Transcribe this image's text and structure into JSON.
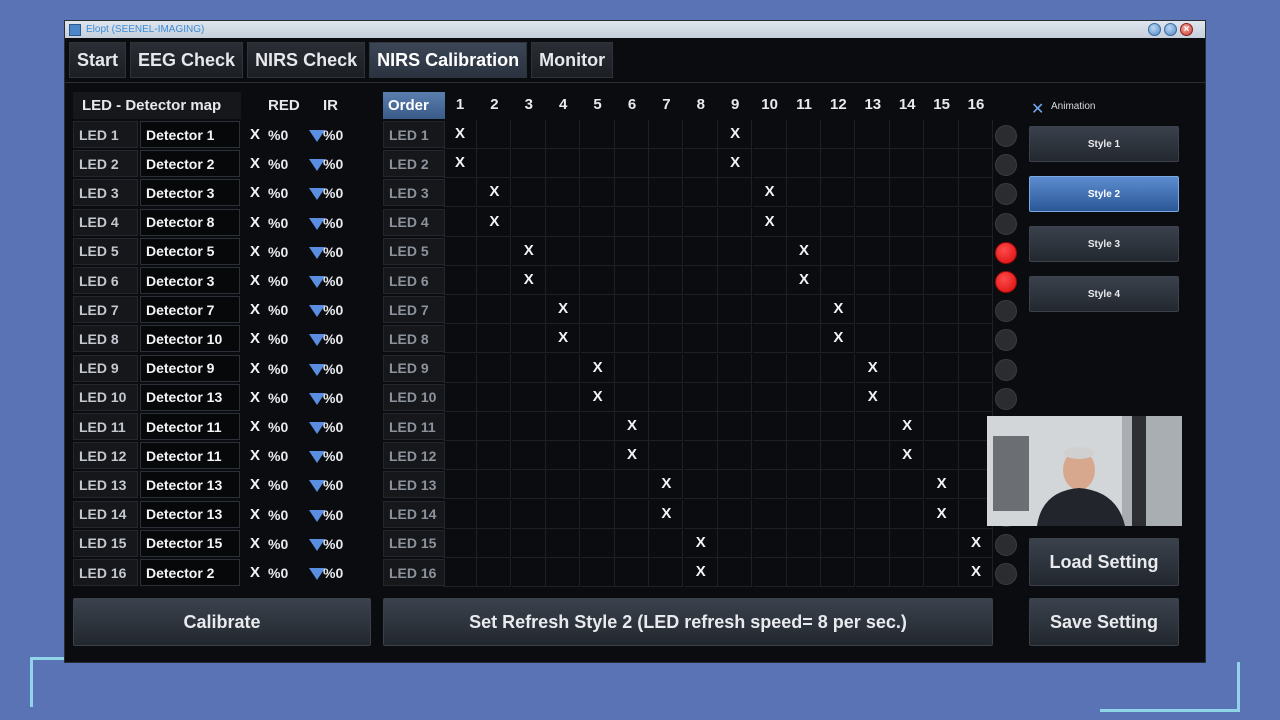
{
  "window": {
    "title": "Elopt (SEENEL-IMAGING)",
    "close_glyph": "×"
  },
  "tabs": [
    "Start",
    "EEG Check",
    "NIRS Check",
    "NIRS Calibration",
    "Monitor"
  ],
  "active_tab": "NIRS Calibration",
  "map": {
    "title": "LED - Detector map",
    "col_red": "RED",
    "col_ir": "IR",
    "rows": [
      {
        "led": "LED 1",
        "detector": "Detector 1",
        "x": "X",
        "red": "%0",
        "ir": "%0"
      },
      {
        "led": "LED 2",
        "detector": "Detector 2",
        "x": "X",
        "red": "%0",
        "ir": "%0"
      },
      {
        "led": "LED 3",
        "detector": "Detector 3",
        "x": "X",
        "red": "%0",
        "ir": "%0"
      },
      {
        "led": "LED 4",
        "detector": "Detector 8",
        "x": "X",
        "red": "%0",
        "ir": "%0"
      },
      {
        "led": "LED 5",
        "detector": "Detector 5",
        "x": "X",
        "red": "%0",
        "ir": "%0"
      },
      {
        "led": "LED 6",
        "detector": "Detector 3",
        "x": "X",
        "red": "%0",
        "ir": "%0"
      },
      {
        "led": "LED 7",
        "detector": "Detector 7",
        "x": "X",
        "red": "%0",
        "ir": "%0"
      },
      {
        "led": "LED 8",
        "detector": "Detector 10",
        "x": "X",
        "red": "%0",
        "ir": "%0"
      },
      {
        "led": "LED 9",
        "detector": "Detector 9",
        "x": "X",
        "red": "%0",
        "ir": "%0"
      },
      {
        "led": "LED 10",
        "detector": "Detector 13",
        "x": "X",
        "red": "%0",
        "ir": "%0"
      },
      {
        "led": "LED 11",
        "detector": "Detector 11",
        "x": "X",
        "red": "%0",
        "ir": "%0"
      },
      {
        "led": "LED 12",
        "detector": "Detector 11",
        "x": "X",
        "red": "%0",
        "ir": "%0"
      },
      {
        "led": "LED 13",
        "detector": "Detector 13",
        "x": "X",
        "red": "%0",
        "ir": "%0"
      },
      {
        "led": "LED 14",
        "detector": "Detector 13",
        "x": "X",
        "red": "%0",
        "ir": "%0"
      },
      {
        "led": "LED 15",
        "detector": "Detector 15",
        "x": "X",
        "red": "%0",
        "ir": "%0"
      },
      {
        "led": "LED 16",
        "detector": "Detector 2",
        "x": "X",
        "red": "%0",
        "ir": "%0"
      }
    ]
  },
  "order_grid": {
    "header": "Order",
    "columns": [
      "1",
      "2",
      "3",
      "4",
      "5",
      "6",
      "7",
      "8",
      "9",
      "10",
      "11",
      "12",
      "13",
      "14",
      "15",
      "16"
    ],
    "mark": "X",
    "rows": [
      {
        "led": "LED 1",
        "marks": [
          1,
          9
        ]
      },
      {
        "led": "LED 2",
        "marks": [
          1,
          9
        ]
      },
      {
        "led": "LED 3",
        "marks": [
          2,
          10
        ]
      },
      {
        "led": "LED 4",
        "marks": [
          2,
          10
        ]
      },
      {
        "led": "LED 5",
        "marks": [
          3,
          11
        ]
      },
      {
        "led": "LED 6",
        "marks": [
          3,
          11
        ]
      },
      {
        "led": "LED 7",
        "marks": [
          4,
          12
        ]
      },
      {
        "led": "LED 8",
        "marks": [
          4,
          12
        ]
      },
      {
        "led": "LED 9",
        "marks": [
          5,
          13
        ]
      },
      {
        "led": "LED 10",
        "marks": [
          5,
          13
        ]
      },
      {
        "led": "LED 11",
        "marks": [
          6,
          14
        ]
      },
      {
        "led": "LED 12",
        "marks": [
          6,
          14
        ]
      },
      {
        "led": "LED 13",
        "marks": [
          7,
          15
        ]
      },
      {
        "led": "LED 14",
        "marks": [
          7,
          15
        ]
      },
      {
        "led": "LED 15",
        "marks": [
          8,
          16
        ]
      },
      {
        "led": "LED 16",
        "marks": [
          8,
          16
        ]
      }
    ]
  },
  "indicators": [
    "off",
    "off",
    "off",
    "off",
    "red",
    "red",
    "off",
    "off",
    "off",
    "off",
    "off",
    "off",
    "off",
    "off",
    "off",
    "off"
  ],
  "colors": {
    "indicator_on": "#e01010",
    "indicator_off": "#2a2c30",
    "accent": "#5a8ee0"
  },
  "animation": {
    "checkbox": "✕",
    "label": "Animation"
  },
  "styles": [
    "Style 1",
    "Style 2",
    "Style 3",
    "Style 4"
  ],
  "active_style": "Style 2",
  "buttons": {
    "calibrate": "Calibrate",
    "refresh_status": "Set Refresh Style 2 (LED refresh speed= 8 per sec.)",
    "load": "Load Setting",
    "save": "Save Setting"
  }
}
